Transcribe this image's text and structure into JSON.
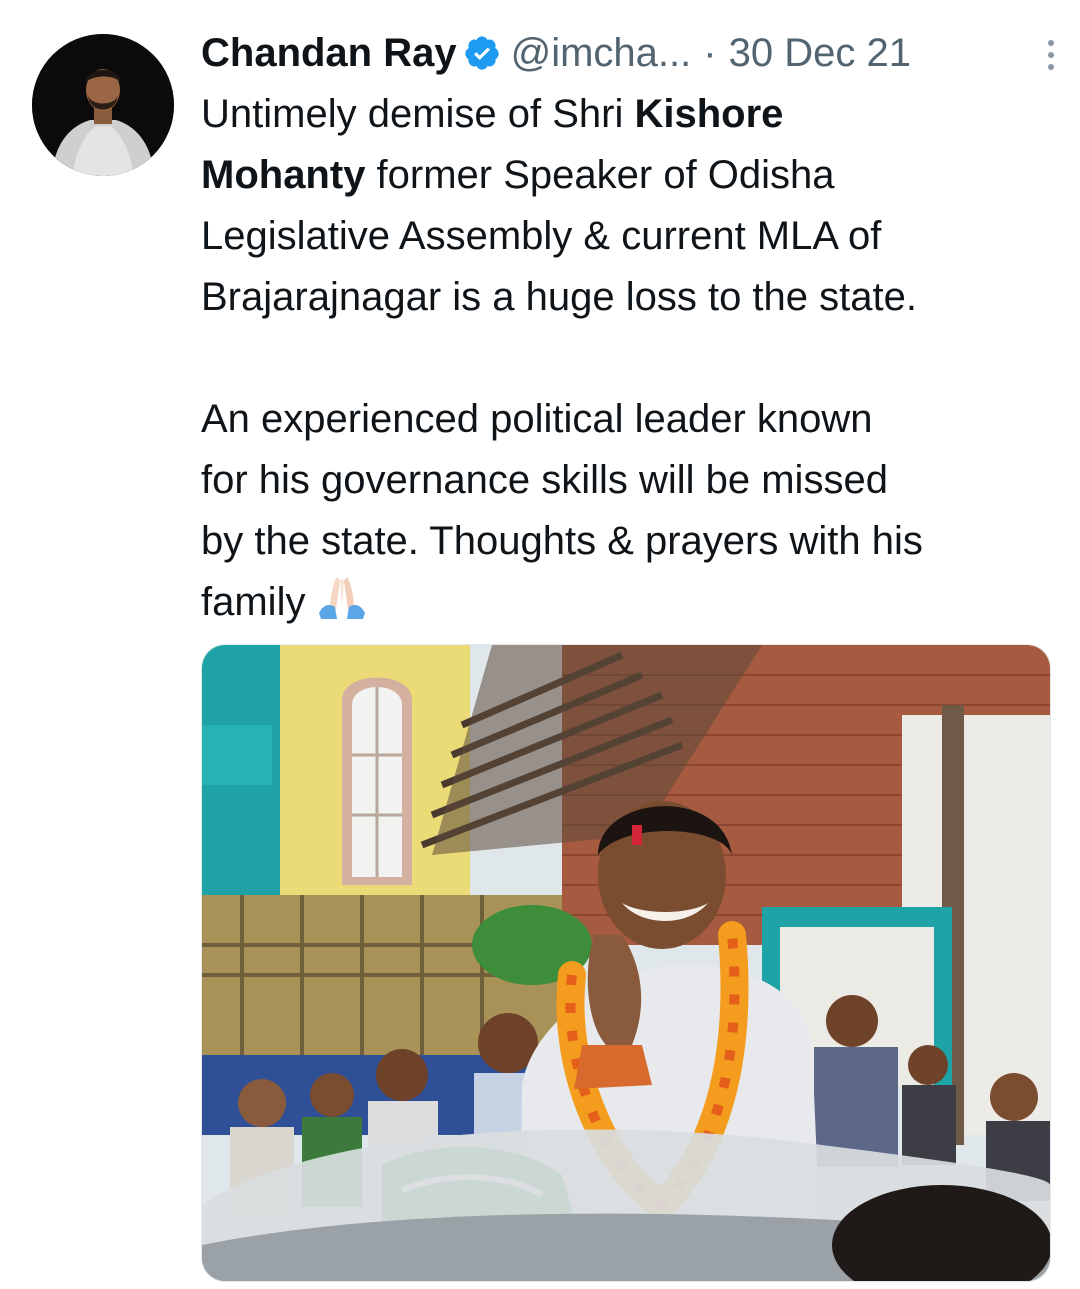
{
  "tweet": {
    "author_name": "Chandan Ray",
    "handle": "@imcha...",
    "separator": "·",
    "date": "30 Dec 21",
    "text": {
      "line1_prefix": "Untimely demise of Shri ",
      "line1_bold": "Kishore",
      "line2_bold": "Mohanty",
      "line2_suffix": " former Speaker of Odisha",
      "line3": "Legislative Assembly & current MLA of",
      "line4": "Brajarajnagar is a huge loss to the state.",
      "para2_line1": "An experienced political leader known",
      "para2_line2": "for his governance skills will be missed",
      "para2_line3": "by the state. Thoughts & prayers with his",
      "para2_line4": "family"
    },
    "emoji": "folded-hands",
    "colors": {
      "text": "#0f1419",
      "secondary": "#536471",
      "verified": "#1d9bf0"
    }
  }
}
